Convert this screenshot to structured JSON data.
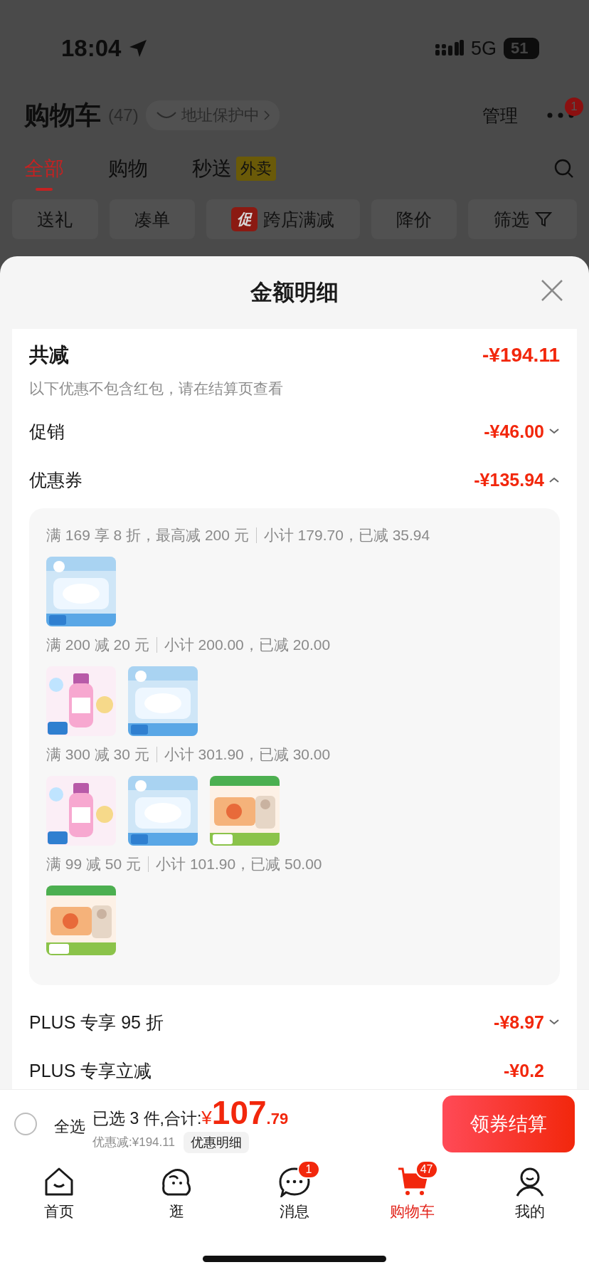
{
  "status_bar": {
    "time": "18:04",
    "network": "5G",
    "battery": "51"
  },
  "header": {
    "title": "购物车",
    "count": "(47)",
    "address_chip": "地址保护中",
    "manage": "管理",
    "more_badge": "1"
  },
  "tabs": [
    {
      "label": "全部",
      "selected": true
    },
    {
      "label": "购物",
      "selected": false
    },
    {
      "label": "秒送",
      "badge": "外卖",
      "selected": false
    }
  ],
  "filters": [
    {
      "kind": "plain",
      "label": "送礼"
    },
    {
      "kind": "plain",
      "label": "凑单"
    },
    {
      "kind": "tagged",
      "tag": "促",
      "label": "跨店满减"
    },
    {
      "kind": "plain",
      "label": "降价"
    },
    {
      "kind": "filter",
      "label": "筛选"
    }
  ],
  "sheet": {
    "title": "金额明细",
    "total": {
      "label": "共减",
      "amount": "-¥194.11",
      "note": "以下优惠不包含红包，请在结算页查看"
    },
    "rows": [
      {
        "label": "促销",
        "amount": "-¥46.00",
        "expanded": false
      },
      {
        "label": "优惠券",
        "amount": "-¥135.94",
        "expanded": true,
        "groups": [
          {
            "rule": "满 169 享 8 折，最高减 200 元",
            "subtotal": "小计 179.70，已减 35.94"
          },
          {
            "rule": "满 200 减 20 元",
            "subtotal": "小计 200.00，已减 20.00"
          },
          {
            "rule": "满 300 减 30 元",
            "subtotal": "小计 301.90，已减 30.00"
          },
          {
            "rule": "满 99 减 50 元",
            "subtotal": "小计 101.90，已减 50.00"
          }
        ]
      },
      {
        "label": "PLUS 专享 95 折",
        "amount": "-¥8.97",
        "expanded": false
      },
      {
        "label": "PLUS 专享立减",
        "amount": "-¥0.2"
      }
    ]
  },
  "checkout_bar": {
    "select_all": {
      "label": "全选",
      "checked": false
    },
    "summary": "已选 3 件,合计:",
    "currency": "¥",
    "price_int": "107",
    "price_dec": ".79",
    "discount": "优惠减:¥194.11",
    "detail_button": "优惠明细",
    "checkout_button": "领券结算"
  },
  "tab_bar": [
    {
      "kind": "home",
      "label": "首页",
      "selected": false
    },
    {
      "kind": "explore",
      "label": "逛",
      "selected": false
    },
    {
      "kind": "messages",
      "label": "消息",
      "badge": "1",
      "selected": false
    },
    {
      "kind": "cart",
      "label": "购物车",
      "badge": "47",
      "selected": true
    },
    {
      "kind": "profile",
      "label": "我的",
      "selected": false
    }
  ]
}
